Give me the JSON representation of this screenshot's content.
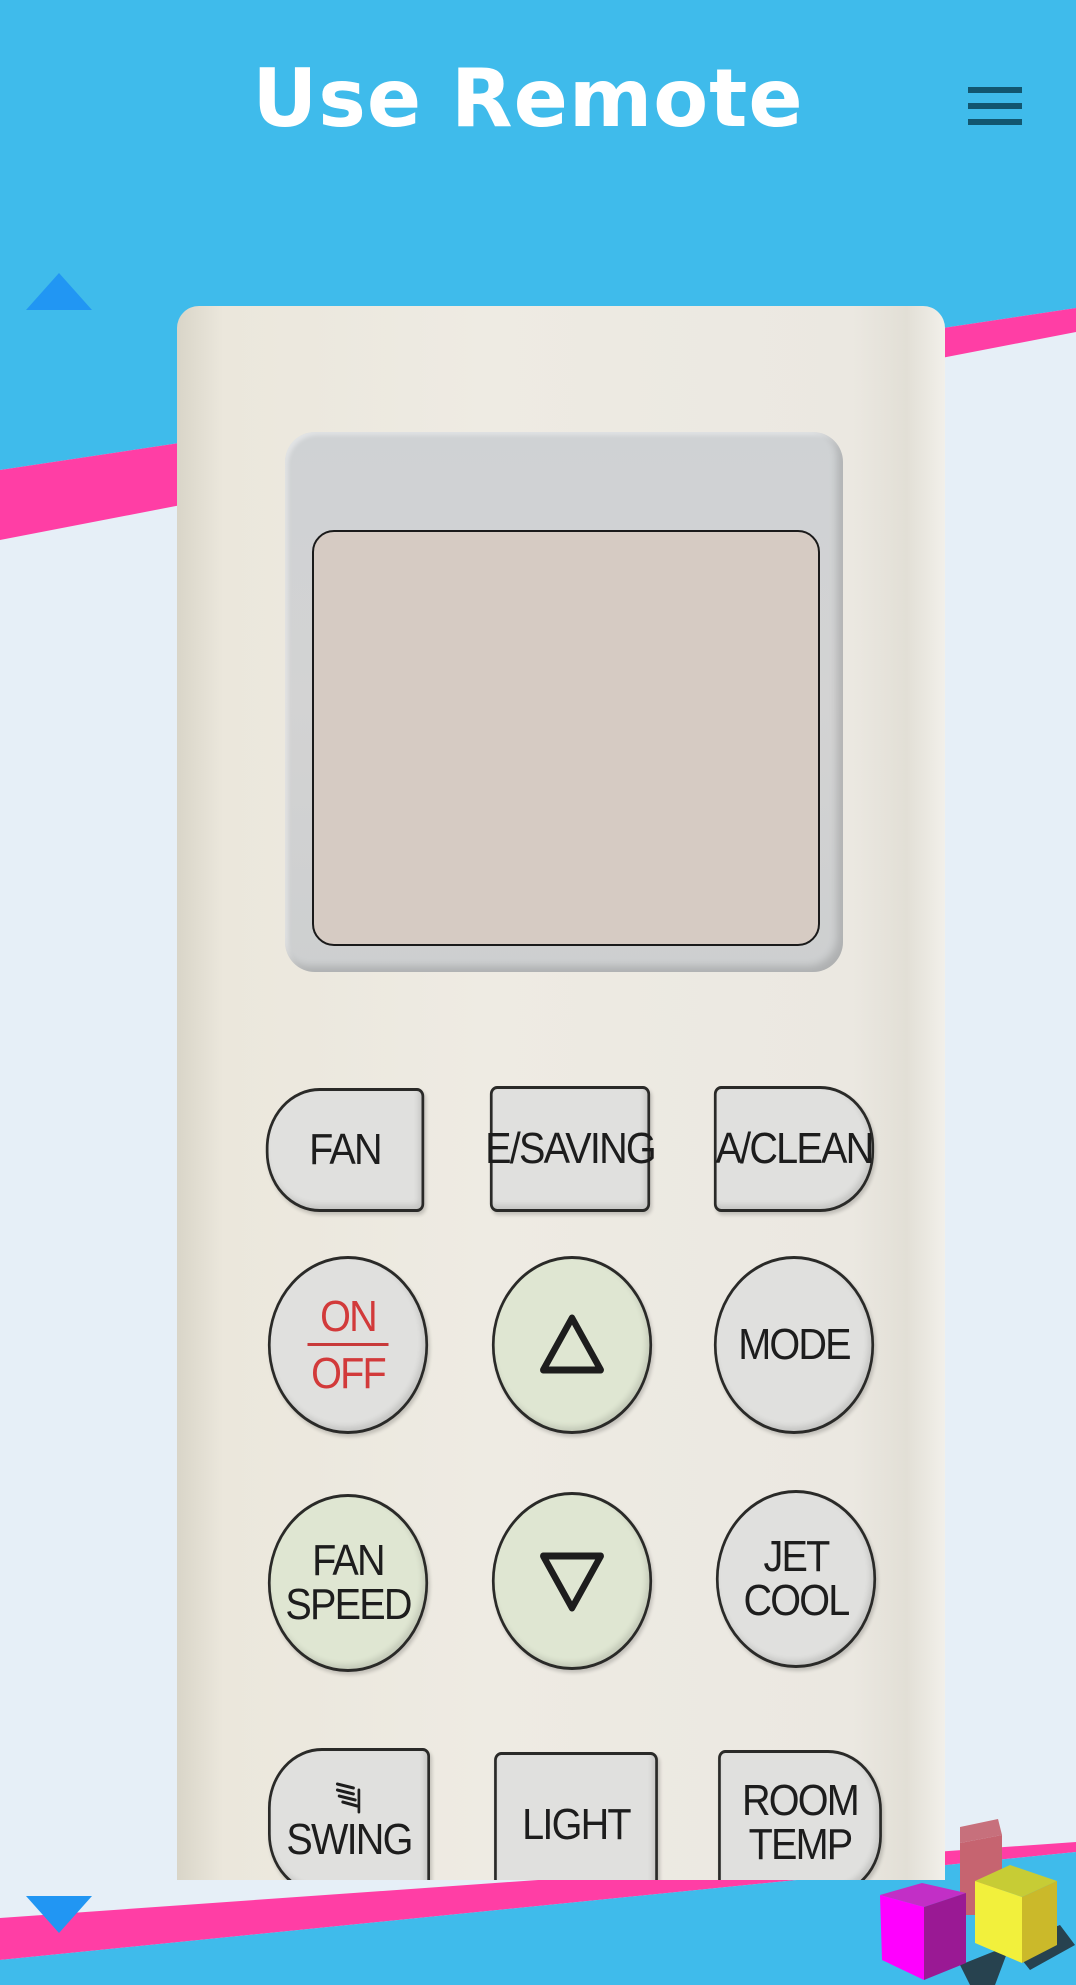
{
  "header": {
    "title": "Use Remote",
    "menu_icon": "hamburger-menu-icon"
  },
  "colors": {
    "header_bg": "#3fbbeb",
    "accent_pink": "#ff3ea5",
    "page_bg": "#e6eff7",
    "arrow_blue": "#2196f3",
    "menu_icon": "#125670",
    "on_off_red": "#d23a3a"
  },
  "nav": {
    "scroll_up_icon": "triangle-up-icon",
    "scroll_down_icon": "triangle-down-icon"
  },
  "remote": {
    "display_text": "",
    "rows": [
      [
        "FAN",
        "E/SAVING",
        "A/CLEAN"
      ],
      [
        "ON",
        "OFF",
        "MODE"
      ],
      [
        "FAN",
        "SPEED",
        "JET",
        "COOL"
      ],
      [
        "SWING",
        "LIGHT",
        "ROOM",
        "TEMP"
      ]
    ],
    "buttons": {
      "fan": "FAN",
      "esaving": "E/SAVING",
      "aclean": "A/CLEAN",
      "on": "ON",
      "off": "OFF",
      "mode": "MODE",
      "temp_label": "TEMP",
      "fan_speed_1": "FAN",
      "fan_speed_2": "SPEED",
      "jet_cool_1": "JET",
      "jet_cool_2": "COOL",
      "swing": "SWING",
      "light": "LIGHT",
      "room_temp_1": "ROOM",
      "room_temp_2": "TEMP"
    }
  }
}
